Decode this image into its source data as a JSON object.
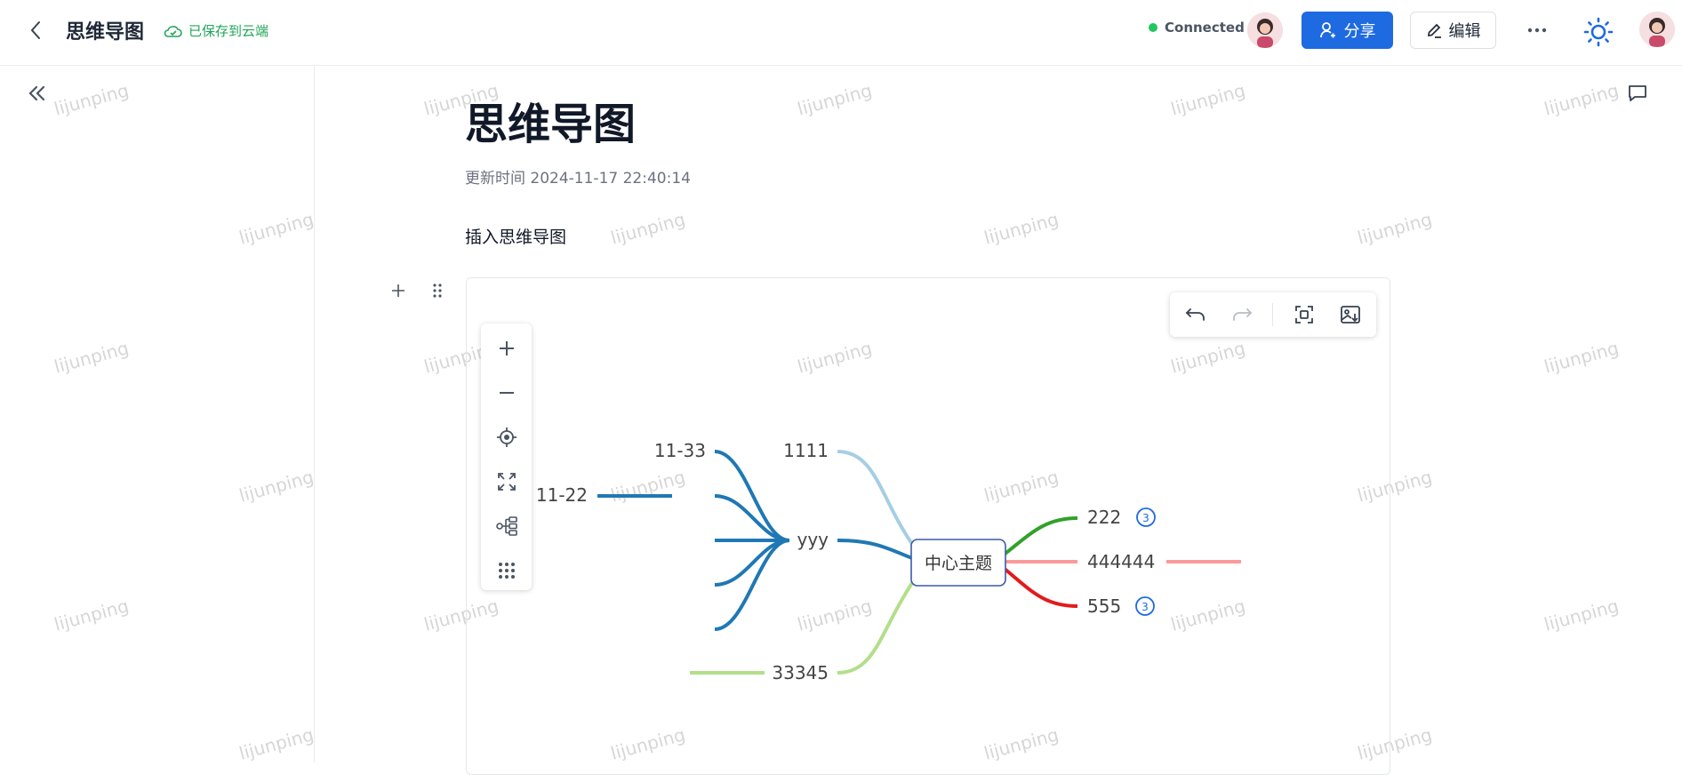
{
  "header": {
    "title": "思维导图",
    "saved_status": "已保存到云端",
    "connection": "Connected",
    "share_label": "分享",
    "edit_label": "编辑",
    "colors": {
      "brand": "#1e6ae1",
      "saved": "#22a55a",
      "connected": "#22c55e"
    }
  },
  "document": {
    "title": "思维导图",
    "updated": "更新时间 2024-11-17 22:40:14",
    "paragraph": "插入思维导图"
  },
  "watermark": "lijunping",
  "mindmap": {
    "root": "中心主题",
    "nodes": {
      "n1111": "1111",
      "nyyy": "yyy",
      "n1133": "11-33",
      "n1122": "11-22",
      "n33345": "33345",
      "n222": "222",
      "n444444": "444444",
      "n555": "555"
    },
    "badges": {
      "b222": "3",
      "b555": "3"
    },
    "colors": {
      "branch_1111": "#a6cee3",
      "branch_yyy": "#1f78b4",
      "branch_33345": "#b2df8a",
      "branch_222": "#33a02c",
      "branch_444444": "#fb9a99",
      "branch_555": "#e31a1c"
    }
  },
  "toolbars": {
    "left": [
      "zoom-in-icon",
      "zoom-out-icon",
      "locate-icon",
      "fullscreen-icon",
      "structure-icon",
      "grid-icon"
    ],
    "top": [
      "undo-icon",
      "redo-icon",
      "fit-icon",
      "export-image-icon"
    ]
  }
}
